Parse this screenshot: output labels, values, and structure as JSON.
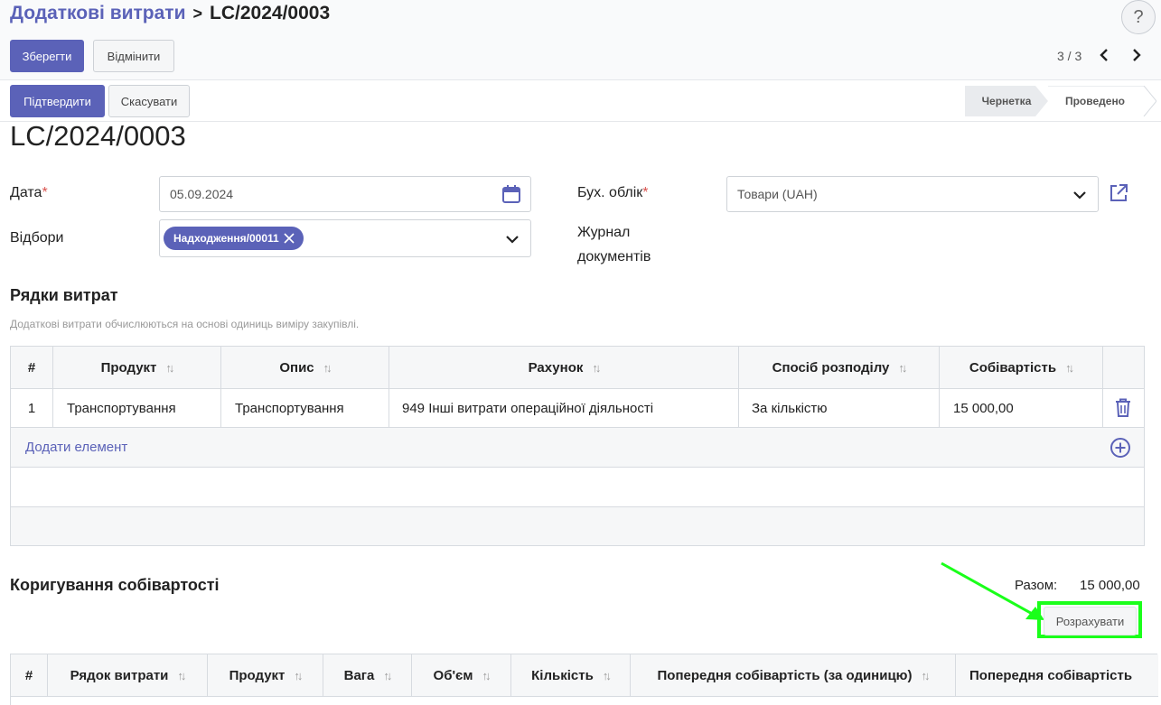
{
  "header": {
    "breadcrumb_parent": "Додаткові витрати",
    "breadcrumb_sep": ">",
    "breadcrumb_current": "LC/2024/0003",
    "help": "?"
  },
  "toolbar": {
    "save_label": "Зберегти",
    "discard_label": "Відмінити",
    "pager": "3 / 3",
    "prev_icon": "‹",
    "next_icon": "›"
  },
  "actions": {
    "confirm_label": "Підтвердити",
    "cancel_label": "Скасувати",
    "stages": [
      "Чернетка",
      "Проведено"
    ]
  },
  "record": {
    "title": "LC/2024/0003"
  },
  "form": {
    "date_label": "Дата",
    "date_value": "05.09.2024",
    "pickings_label": "Відбори",
    "picking_tag": "Надходження/00011",
    "account_label": "Бух. облік",
    "account_value": "Товари (UAH)",
    "journal_label_1": "Журнал",
    "journal_label_2": "документів",
    "required_mark": "*"
  },
  "cost_lines": {
    "title": "Рядки витрат",
    "hint": "Додаткові витрати обчислюються на основі одиниць виміру закупівлі.",
    "columns": [
      "#",
      "Продукт",
      "Опис",
      "Рахунок",
      "Спосіб розподілу",
      "Собівартість"
    ],
    "rows": [
      {
        "num": "1",
        "product": "Транспортування",
        "description": "Транспортування",
        "account": "949 Інші витрати операційної діяльності",
        "split": "За кількістю",
        "cost": "15 000,00"
      }
    ],
    "add_label": "Додати елемент"
  },
  "valuation": {
    "title": "Коригування собівартості",
    "total_label": "Разом:",
    "total_value": "15 000,00",
    "compute_label": "Розрахувати",
    "columns": [
      "#",
      "Рядок витрати",
      "Продукт",
      "Вага",
      "Об'єм",
      "Кількість",
      "Попередня собівартість (за одиницю)",
      "Попередня собівартість"
    ]
  },
  "colors": {
    "brand": "#5b62b8",
    "highlight": "#1aff1a"
  }
}
